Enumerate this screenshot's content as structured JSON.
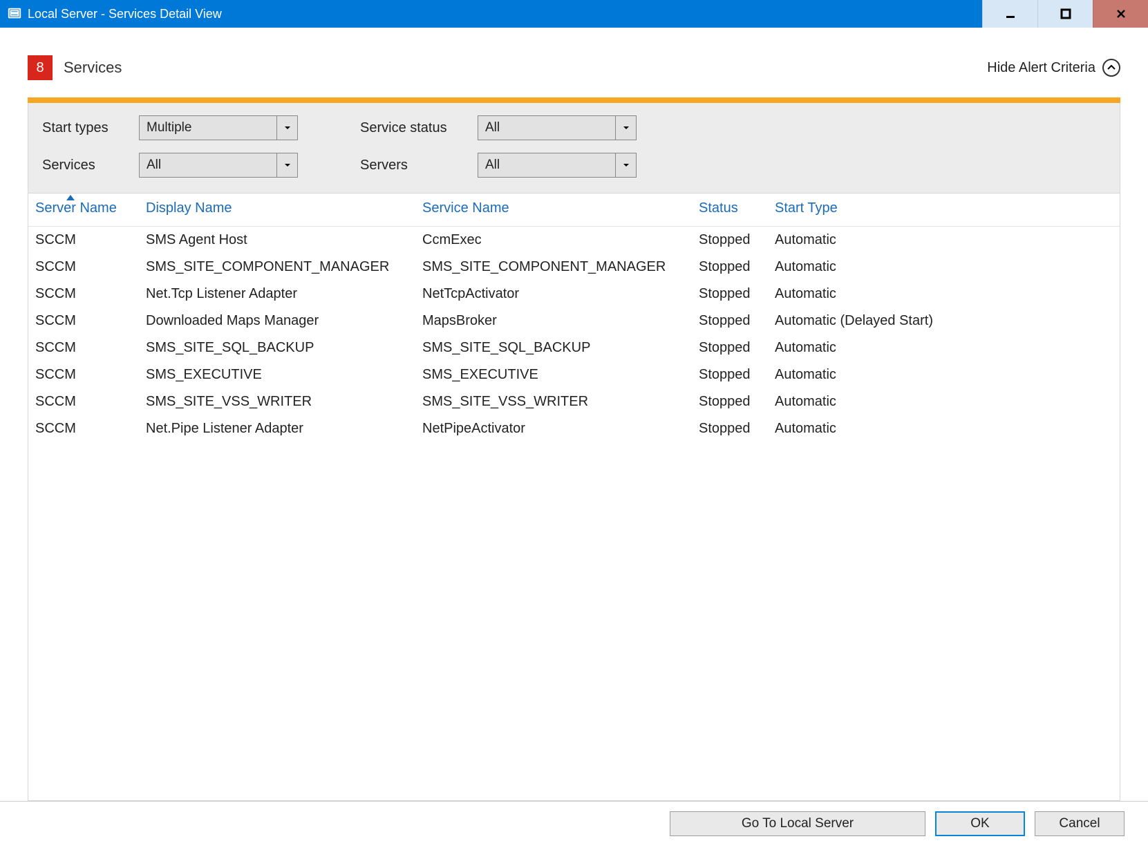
{
  "window": {
    "title": "Local Server - Services Detail View"
  },
  "header": {
    "count": "8",
    "section_label": "Services",
    "hide_criteria_label": "Hide Alert Criteria"
  },
  "filters": {
    "start_types_label": "Start types",
    "start_types_value": "Multiple",
    "services_label": "Services",
    "services_value": "All",
    "service_status_label": "Service status",
    "service_status_value": "All",
    "servers_label": "Servers",
    "servers_value": "All"
  },
  "columns": {
    "server_name": "Server Name",
    "display_name": "Display Name",
    "service_name": "Service Name",
    "status": "Status",
    "start_type": "Start Type"
  },
  "rows": [
    {
      "server": "SCCM",
      "display": "SMS Agent Host",
      "service": "CcmExec",
      "status": "Stopped",
      "start": "Automatic"
    },
    {
      "server": "SCCM",
      "display": "SMS_SITE_COMPONENT_MANAGER",
      "service": "SMS_SITE_COMPONENT_MANAGER",
      "status": "Stopped",
      "start": "Automatic"
    },
    {
      "server": "SCCM",
      "display": "Net.Tcp Listener Adapter",
      "service": "NetTcpActivator",
      "status": "Stopped",
      "start": "Automatic"
    },
    {
      "server": "SCCM",
      "display": "Downloaded Maps Manager",
      "service": "MapsBroker",
      "status": "Stopped",
      "start": "Automatic (Delayed Start)"
    },
    {
      "server": "SCCM",
      "display": "SMS_SITE_SQL_BACKUP",
      "service": "SMS_SITE_SQL_BACKUP",
      "status": "Stopped",
      "start": "Automatic"
    },
    {
      "server": "SCCM",
      "display": "SMS_EXECUTIVE",
      "service": "SMS_EXECUTIVE",
      "status": "Stopped",
      "start": "Automatic"
    },
    {
      "server": "SCCM",
      "display": "SMS_SITE_VSS_WRITER",
      "service": "SMS_SITE_VSS_WRITER",
      "status": "Stopped",
      "start": "Automatic"
    },
    {
      "server": "SCCM",
      "display": "Net.Pipe Listener Adapter",
      "service": "NetPipeActivator",
      "status": "Stopped",
      "start": "Automatic"
    }
  ],
  "footer": {
    "go_to_local_server": "Go To Local Server",
    "ok": "OK",
    "cancel": "Cancel"
  }
}
